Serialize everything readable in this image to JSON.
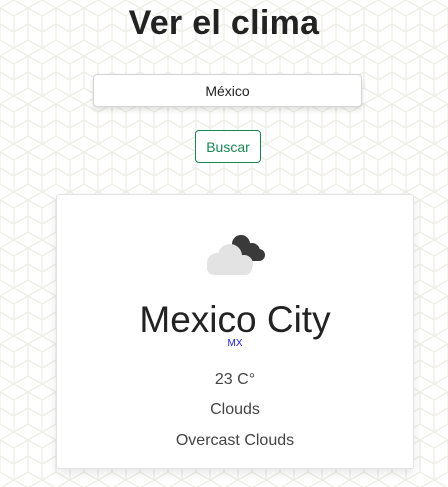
{
  "header": {
    "title": "Ver el clima"
  },
  "search": {
    "value": "México",
    "button_label": "Buscar"
  },
  "weather": {
    "icon": "cloud-icon",
    "city": "Mexico City",
    "country": "MX",
    "temperature": "23 C°",
    "condition": "Clouds",
    "description": "Overcast Clouds"
  },
  "colors": {
    "button_accent": "#198754",
    "country_link": "#1a1aff",
    "background_pattern": "#ecebe3"
  }
}
